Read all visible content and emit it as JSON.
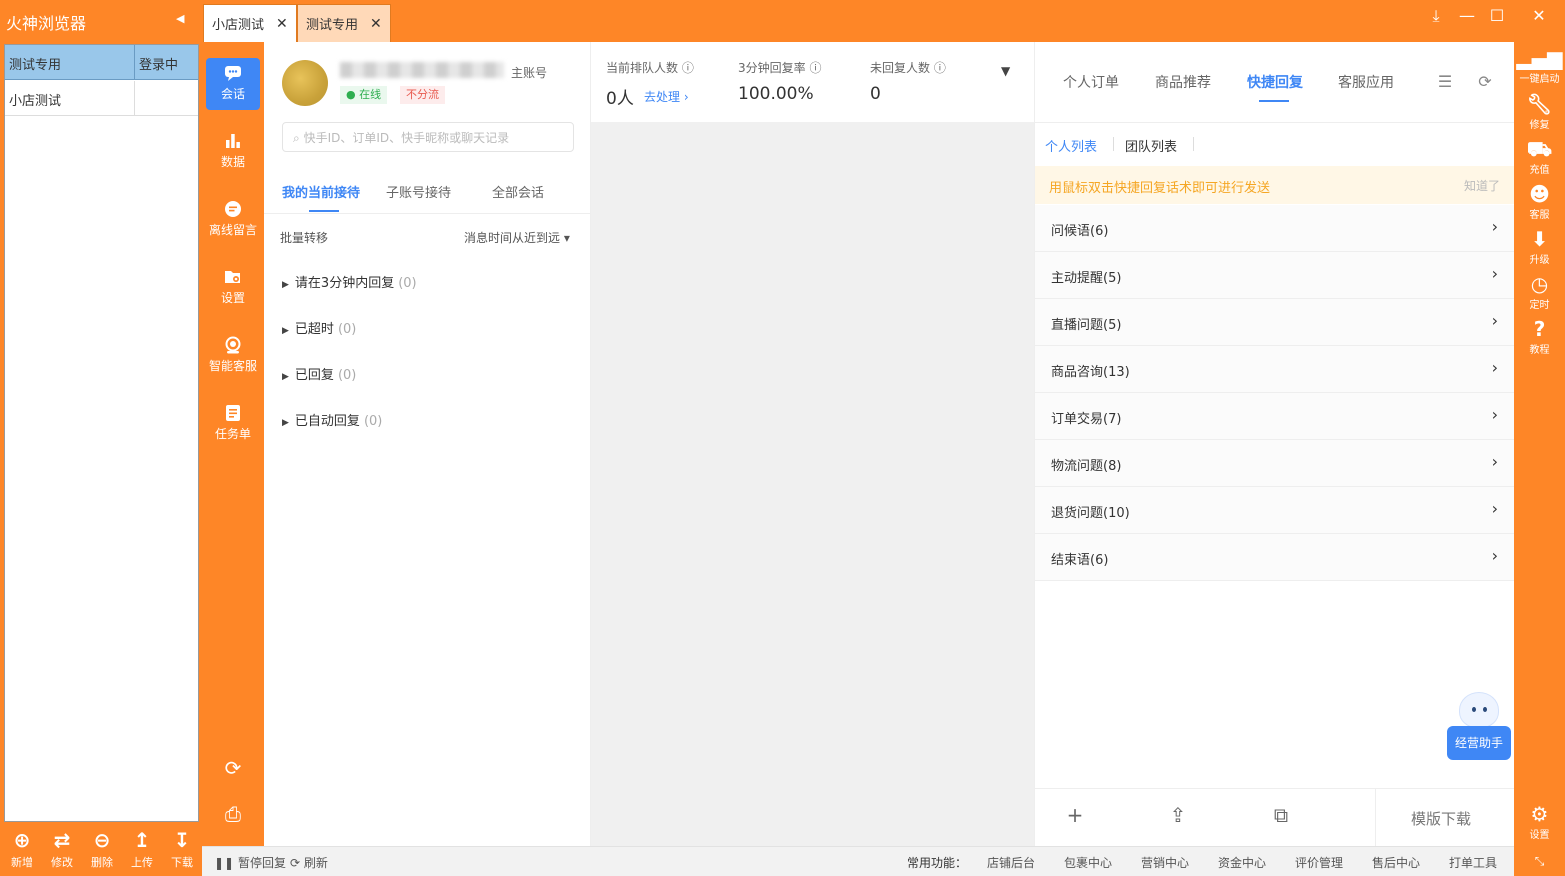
{
  "titlebar": {
    "app_name": "火神浏览器",
    "tabs": [
      {
        "label": "小店测试"
      },
      {
        "label": "测试专用"
      }
    ]
  },
  "accounts": {
    "rows": [
      {
        "name": "测试专用",
        "status": "登录中"
      },
      {
        "name": "小店测试",
        "status": ""
      }
    ]
  },
  "left_toolbar": [
    {
      "label": "新增",
      "icon": "plus-circle-icon"
    },
    {
      "label": "修改",
      "icon": "swap-icon"
    },
    {
      "label": "删除",
      "icon": "minus-circle-icon"
    },
    {
      "label": "上传",
      "icon": "upload-arrow-icon"
    },
    {
      "label": "下载",
      "icon": "download-arrow-icon"
    }
  ],
  "nav": [
    {
      "label": "会话",
      "icon": "chat-icon"
    },
    {
      "label": "数据",
      "icon": "bar-chart-icon"
    },
    {
      "label": "离线留言",
      "icon": "message-icon"
    },
    {
      "label": "设置",
      "icon": "settings-folder-icon"
    },
    {
      "label": "智能客服",
      "icon": "headset-icon"
    },
    {
      "label": "任务单",
      "icon": "task-icon"
    }
  ],
  "profile": {
    "role": "主账号",
    "online": "在线",
    "no_shunt": "不分流",
    "search_placeholder": "快手ID、订单ID、快手昵称或聊天记录"
  },
  "conv_tabs": [
    "我的当前接待",
    "子账号接待",
    "全部会话"
  ],
  "conv_tools": {
    "batch": "批量转移",
    "sort": "消息时间从近到远 ▾"
  },
  "conv_groups": [
    {
      "label": "请在3分钟内回复",
      "count": "(0)"
    },
    {
      "label": "已超时",
      "count": "(0)"
    },
    {
      "label": "已回复",
      "count": "(0)"
    },
    {
      "label": "已自动回复",
      "count": "(0)"
    }
  ],
  "stats": {
    "queue_label": "当前排队人数",
    "queue_value": "0人",
    "queue_link": "去处理",
    "rate_label": "3分钟回复率",
    "rate_value": "100.00%",
    "unreplied_label": "未回复人数",
    "unreplied_value": "0"
  },
  "quick_tabs": [
    "个人订单",
    "商品推荐",
    "快捷回复",
    "客服应用"
  ],
  "quick_subtabs": [
    "个人列表",
    "团队列表"
  ],
  "tip": {
    "text": "用鼠标双击快捷回复话术即可进行发送",
    "dismiss": "知道了"
  },
  "quick_replies": [
    "问候语(6)",
    "主动提醒(5)",
    "直播问题(5)",
    "商品咨询(13)",
    "订单交易(7)",
    "物流问题(8)",
    "退货问题(10)",
    "结束语(6)"
  ],
  "assistant": "经营助手",
  "template_download": "模版下载",
  "right_bar": [
    {
      "label": "一键启动",
      "icon": "signal-icon"
    },
    {
      "label": "修复",
      "icon": "wrench-icon"
    },
    {
      "label": "充值",
      "icon": "cart-icon"
    },
    {
      "label": "客服",
      "icon": "qq-icon"
    },
    {
      "label": "升级",
      "icon": "download-icon"
    },
    {
      "label": "定时",
      "icon": "clock-icon"
    },
    {
      "label": "教程",
      "icon": "help-icon"
    },
    {
      "label": "设置",
      "icon": "gear-icon"
    }
  ],
  "status_bar": {
    "pause": "暂停回复",
    "refresh": "刷新",
    "func_label": "常用功能：",
    "links": [
      "店铺后台",
      "包裹中心",
      "营销中心",
      "资金中心",
      "评价管理",
      "售后中心",
      "打单工具"
    ]
  },
  "colors": {
    "brand": "#fe8627",
    "accent": "#3f87f5"
  }
}
